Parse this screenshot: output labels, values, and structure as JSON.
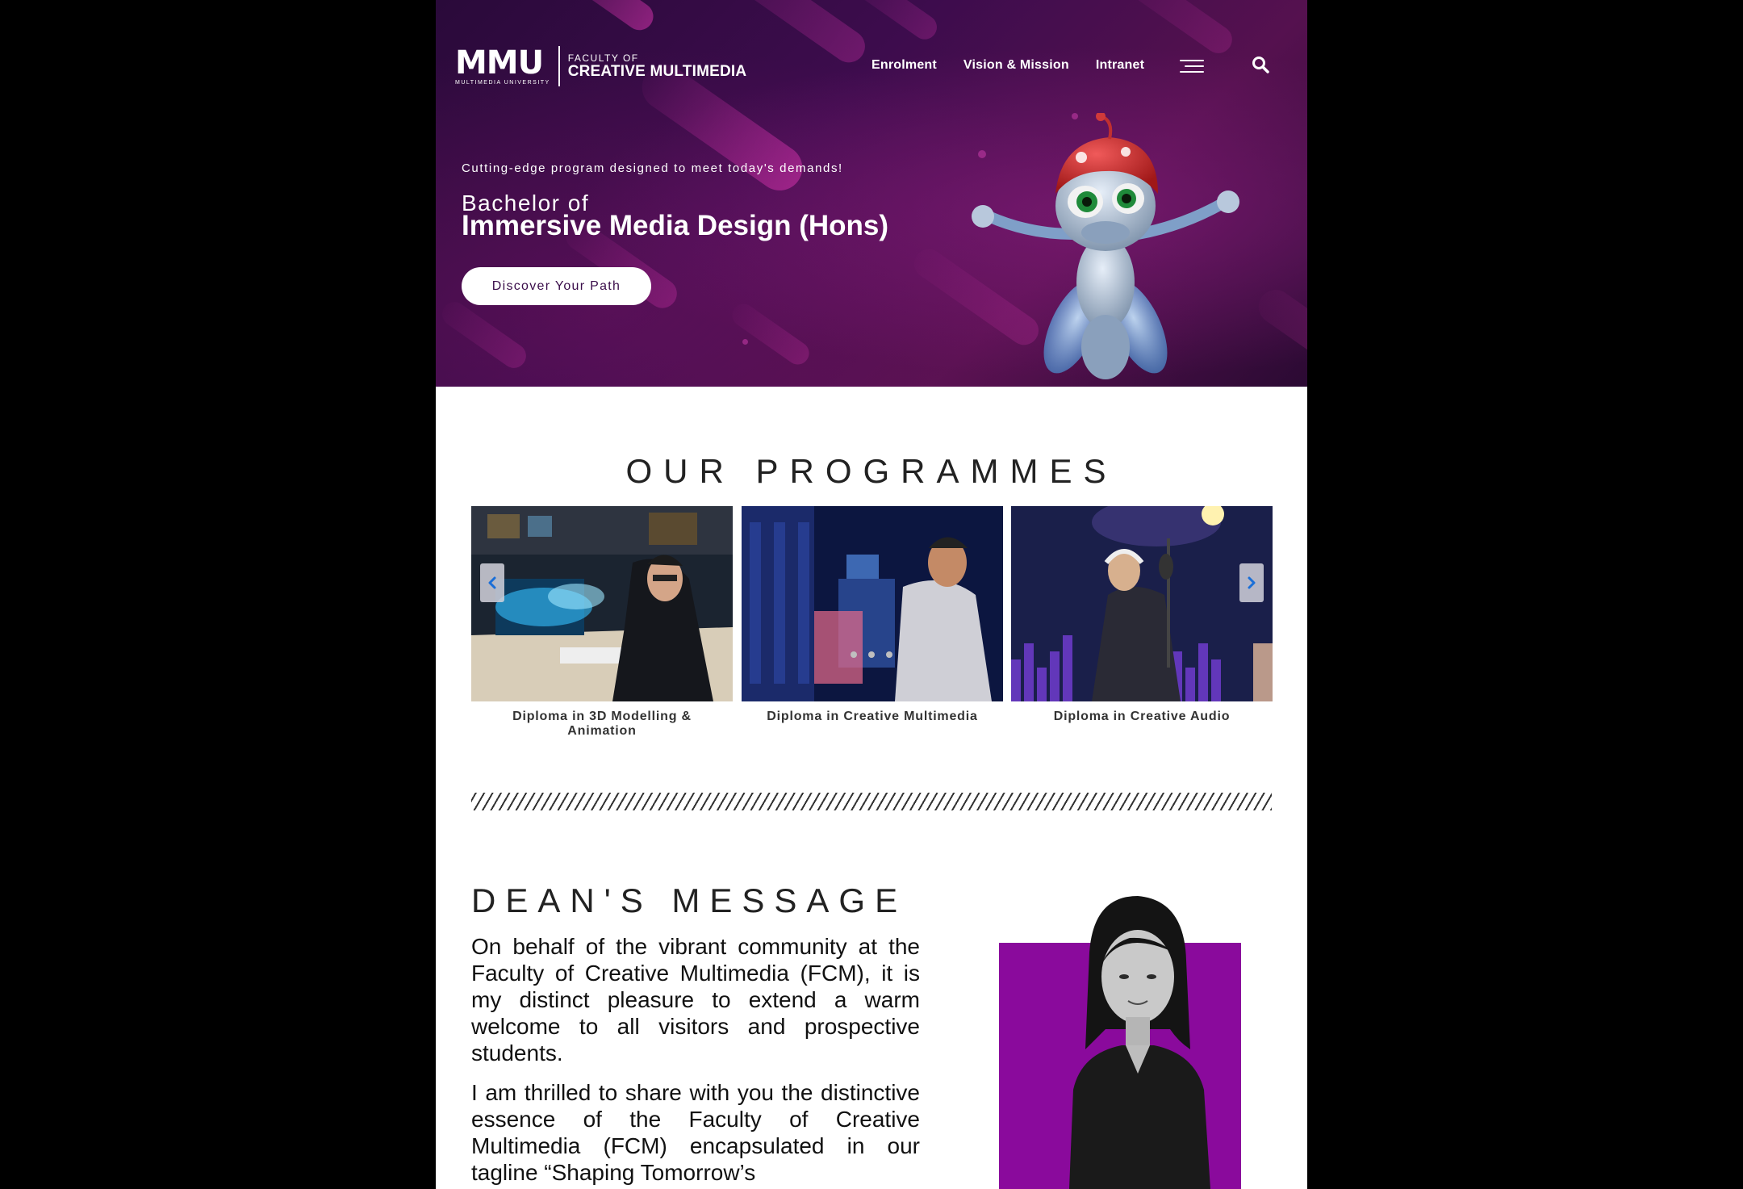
{
  "header": {
    "logo": {
      "main": "MMU",
      "sub": "MULTIMEDIA UNIVERSITY",
      "faculty_of": "FACULTY OF",
      "faculty_name": "CREATIVE MULTIMEDIA"
    },
    "nav": [
      {
        "label": "Enrolment"
      },
      {
        "label": "Vision & Mission"
      },
      {
        "label": "Intranet"
      }
    ],
    "menu_icon": "hamburger-menu-icon",
    "search_icon": "search-icon"
  },
  "hero": {
    "tagline": "Cutting-edge program designed to meet today's demands!",
    "pre_title": "Bachelor of",
    "title": "Immersive Media Design (Hons)",
    "cta_label": "Discover Your Path",
    "colors": {
      "bg_dark": "#2a0a3a",
      "accent": "#c8289e"
    }
  },
  "programmes": {
    "heading": "OUR PROGRAMMES",
    "items": [
      {
        "label": "Diploma in 3D Modelling & Animation"
      },
      {
        "label": "Diploma in Creative Multimedia"
      },
      {
        "label": "Diploma in Creative Audio"
      }
    ],
    "prev_icon": "chevron-left-icon",
    "next_icon": "chevron-right-icon",
    "arrow_color": "#1a6fd8"
  },
  "dean": {
    "heading": "DEAN'S MESSAGE",
    "paragraphs": [
      "On behalf of the vibrant community at the Faculty of Creative Multimedia (FCM), it is my distinct pleasure to extend a warm welcome to all visitors and prospective students.",
      "I am thrilled to share with you the distinctive essence of the Faculty of Creative Multimedia (FCM) encapsulated in our tagline “Shaping Tomorrow’s"
    ],
    "photo_bg_color": "#8a0a9c"
  }
}
